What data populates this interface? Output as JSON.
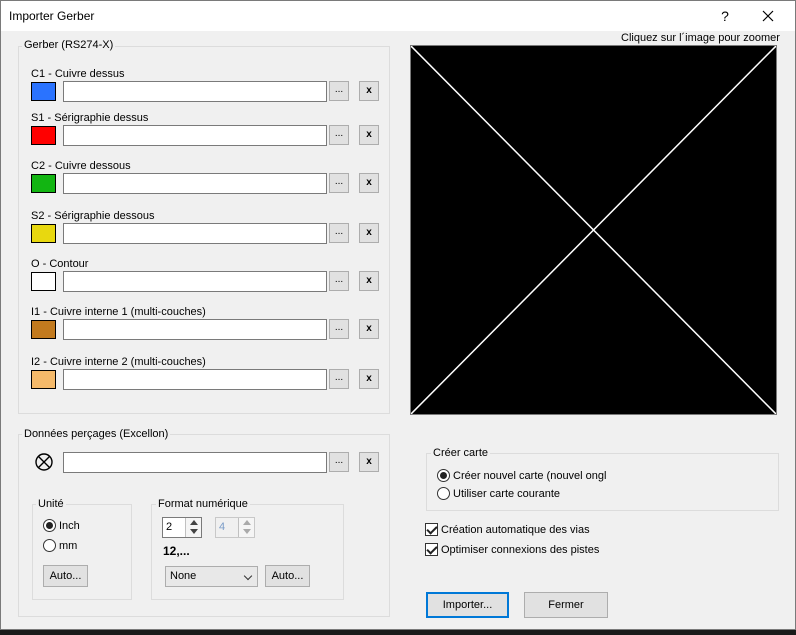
{
  "window": {
    "title": "Importer Gerber",
    "help": "?",
    "close": "✕"
  },
  "gerber": {
    "title": "Gerber (RS274-X)",
    "layers": [
      {
        "label": "C1 - Cuivre dessus",
        "color": "#2a73ff",
        "path": ""
      },
      {
        "label": "S1 - Sérigraphie dessus",
        "color": "#ff0000",
        "path": ""
      },
      {
        "label": "C2 - Cuivre dessous",
        "color": "#12b512",
        "path": ""
      },
      {
        "label": "S2 - Sérigraphie dessous",
        "color": "#e8d80f",
        "path": ""
      },
      {
        "label": "O - Contour",
        "color": "#ffffff",
        "path": ""
      },
      {
        "label": "I1 - Cuivre interne 1 (multi-couches)",
        "color": "#c27a1e",
        "path": ""
      },
      {
        "label": "I2 - Cuivre interne 2 (multi-couches)",
        "color": "#f4b96a",
        "path": ""
      }
    ],
    "browse_label": "...",
    "clear_label": "x"
  },
  "preview": {
    "hint": "Cliquez sur l´image pour zoomer"
  },
  "drill": {
    "title": "Données perçages (Excellon)",
    "path": "",
    "unit": {
      "title": "Unité",
      "options": [
        "Inch",
        "mm"
      ],
      "selected": 0,
      "auto_label": "Auto..."
    },
    "format": {
      "title": "Format numérique",
      "int_digits": "2",
      "dec_digits": "4",
      "example": "12,...",
      "zeros": "None",
      "auto_label": "Auto..."
    }
  },
  "create": {
    "title": "Créer carte",
    "options": [
      "Créer nouvel carte (nouvel onglet)",
      "Utiliser carte courante"
    ],
    "selected": 0,
    "auto_vias": "Création automatique des vias",
    "optimize": "Optimiser connexions des pistes",
    "auto_vias_checked": true,
    "optimize_checked": true
  },
  "actions": {
    "import": "Importer...",
    "close": "Fermer"
  }
}
